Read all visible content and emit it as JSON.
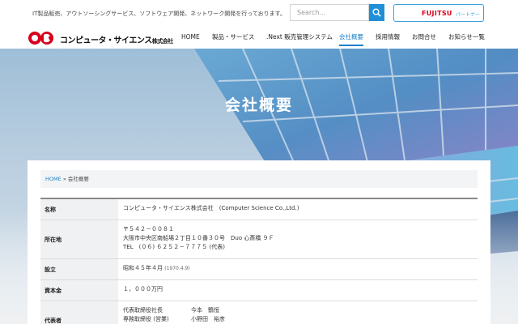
{
  "header": {
    "tagline": "IT製品販売、アウトソーシングサービス、ソフトウェア開発、ネットワーク開発を行っております。",
    "search_placeholder": "Search...",
    "partner": {
      "brand": "FUJITSU",
      "label": "パートナー"
    },
    "logo_text": "コンピュータ・サイエンス",
    "logo_suffix": "株式会社"
  },
  "nav": [
    "HOME",
    "製品・サービス",
    ".Next 販売管理システム",
    "会社概要",
    "採用情報",
    "お問合せ",
    "お知らせ一覧"
  ],
  "nav_active_index": 3,
  "hero": {
    "title": "会社概要"
  },
  "breadcrumb": {
    "home": "HOME",
    "separator": "»",
    "current": "会社概要"
  },
  "company": {
    "name_label": "名称",
    "name_value": "コンピュータ・サイエンス株式会社　(Computer Science Co.,Ltd.)",
    "address_label": "所在地",
    "address_lines": [
      "〒５４２－００８１",
      "大阪市中央区南船場２丁目１０番３０号　Duo 心斎橋 ９Ｆ",
      "TEL　(０６) ６２５２－７７７５ (代表)"
    ],
    "founded_label": "設立",
    "founded_value": "昭和４５年４月",
    "founded_sub": "(1970.4.9)",
    "capital_label": "資本金",
    "capital_value": "１，０００万円",
    "executives_label": "代表者",
    "executives": [
      {
        "title": "代表取締役社長",
        "name": "今本　鶴恒"
      },
      {
        "title": "専務取締役 (営業)",
        "name": "小野田　裕彦"
      }
    ]
  },
  "colors": {
    "accent": "#1a7fc8",
    "search_button": "#1f8fd8",
    "fujitsu_red": "#d8001c"
  }
}
